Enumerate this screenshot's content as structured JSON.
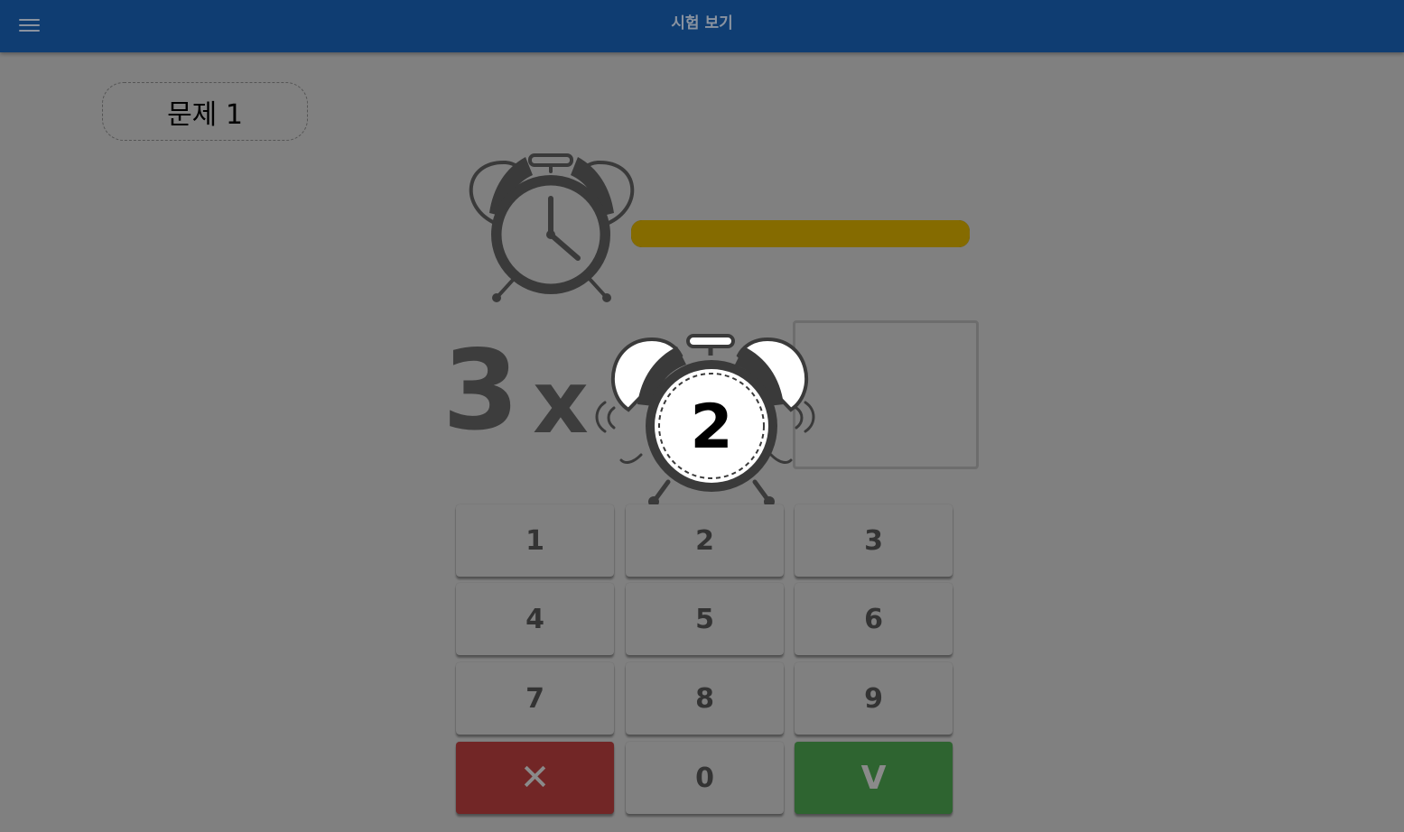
{
  "header": {
    "title": "시험 보기",
    "menu_icon": "hamburger-menu-icon"
  },
  "question": {
    "label": "문제 1"
  },
  "timer": {
    "icon": "alarm-clock-icon",
    "progress": 1.0,
    "color": "#856b00"
  },
  "equation": {
    "left": "3",
    "operator": "x",
    "answer": ""
  },
  "countdown": {
    "value": "2",
    "icon": "ringing-alarm-clock-icon"
  },
  "keypad": {
    "keys": [
      {
        "label": "1"
      },
      {
        "label": "2"
      },
      {
        "label": "3"
      },
      {
        "label": "4"
      },
      {
        "label": "5"
      },
      {
        "label": "6"
      },
      {
        "label": "7"
      },
      {
        "label": "8"
      },
      {
        "label": "9"
      },
      {
        "label": "✕",
        "icon": "clear-icon",
        "color": "#722626"
      },
      {
        "label": "0"
      },
      {
        "label": "V",
        "icon": "submit-check-icon",
        "color": "#2e6430"
      }
    ]
  }
}
